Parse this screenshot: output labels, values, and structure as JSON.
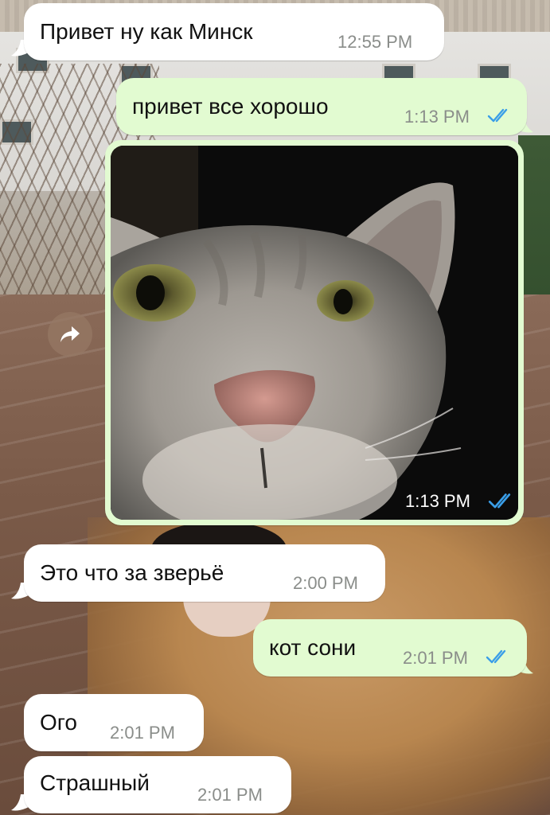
{
  "messages": [
    {
      "text": "Привет ну как Минск",
      "time": "12:55 PM"
    },
    {
      "text": "привет все хорошо",
      "time": "1:13 PM"
    },
    {
      "photo": "cat-photo",
      "time": "1:13 PM"
    },
    {
      "text": "Это что за зверьё",
      "time": "2:00 PM"
    },
    {
      "text": "кот сони",
      "time": "2:01 PM"
    },
    {
      "text": "Ого",
      "time": "2:01 PM"
    },
    {
      "text": "Страшный",
      "time": "2:01 PM"
    }
  ],
  "icons": {
    "forward": "forward-arrow-icon",
    "read_receipt": "double-check-icon"
  },
  "colors": {
    "incoming_bubble": "#ffffff",
    "outgoing_bubble": "#e2fbd1",
    "read_ticks": "#3a9ee8",
    "timestamp": "#8a8d8a"
  }
}
